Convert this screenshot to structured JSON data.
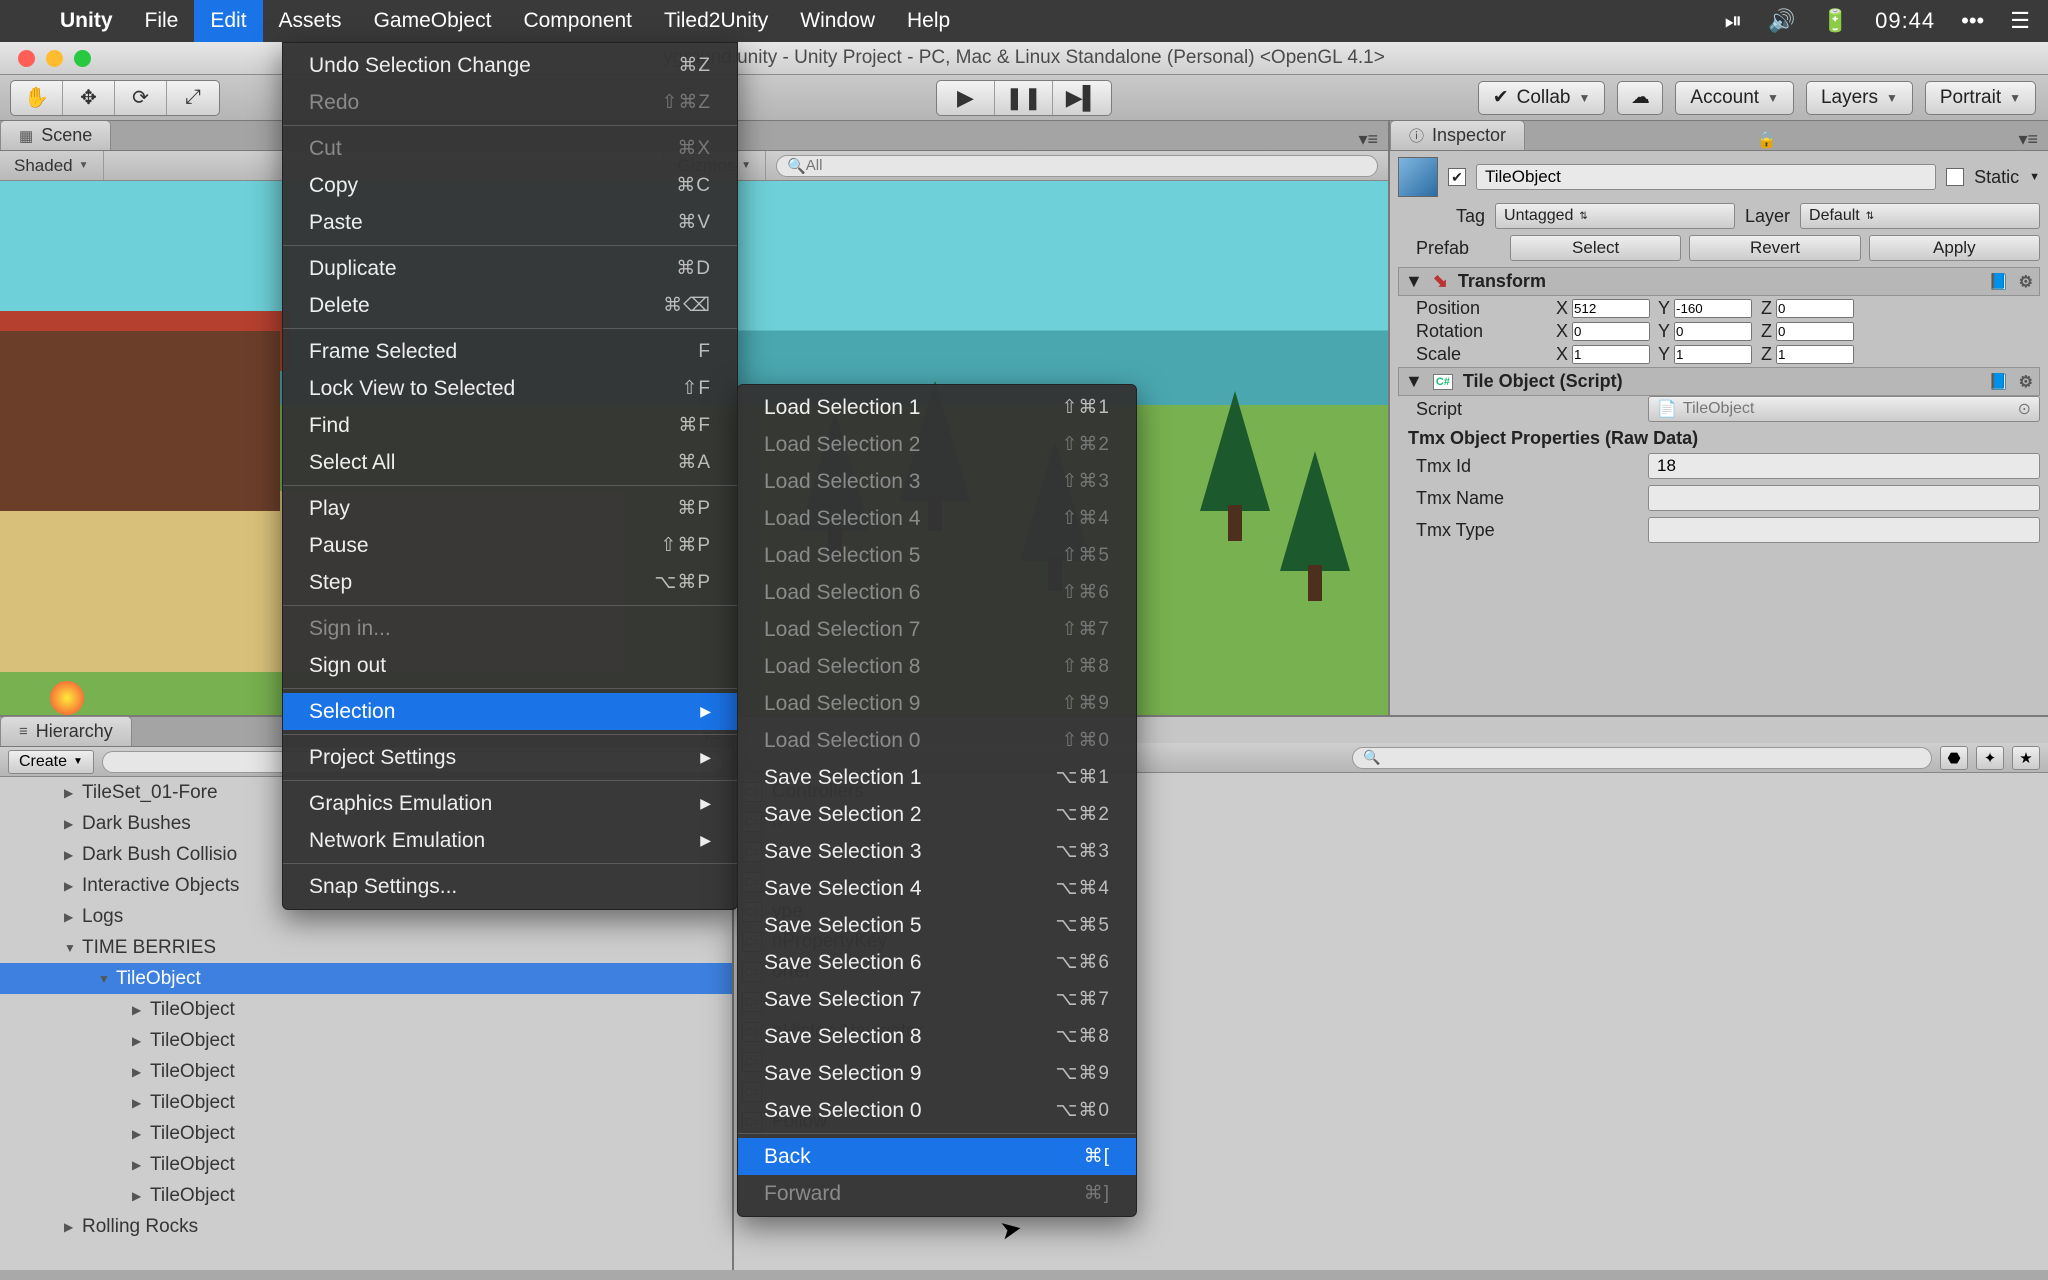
{
  "menubar": {
    "app": "Unity",
    "items": [
      "File",
      "Edit",
      "Assets",
      "GameObject",
      "Component",
      "Tiled2Unity",
      "Window",
      "Help"
    ],
    "active_index": 1,
    "clock": "09:44"
  },
  "window": {
    "title": "yground.unity - Unity Project - PC, Mac & Linux Standalone (Personal) <OpenGL 4.1>"
  },
  "toolbar": {
    "collab": "Collab",
    "account": "Account",
    "layers": "Layers",
    "layout": "Portrait"
  },
  "scene": {
    "tab": "Scene",
    "shading": "Shaded",
    "gizmos": "Gizmos",
    "search_placeholder": "All"
  },
  "hierarchy": {
    "tab": "Hierarchy",
    "create": "Create",
    "items": [
      {
        "label": "TileSet_01-Fore",
        "indent": 1,
        "tri": "▶"
      },
      {
        "label": "Dark Bushes",
        "indent": 1,
        "tri": "▶"
      },
      {
        "label": "Dark Bush Collisio",
        "indent": 1,
        "tri": "▶"
      },
      {
        "label": "Interactive Objects",
        "indent": 1,
        "tri": "▶"
      },
      {
        "label": "Logs",
        "indent": 1,
        "tri": "▶"
      },
      {
        "label": "TIME BERRIES",
        "indent": 1,
        "tri": "▼"
      },
      {
        "label": "TileObject",
        "indent": 2,
        "tri": "▼",
        "selected": true
      },
      {
        "label": "TileObject",
        "indent": 3,
        "tri": "▶"
      },
      {
        "label": "TileObject",
        "indent": 3,
        "tri": "▶"
      },
      {
        "label": "TileObject",
        "indent": 3,
        "tri": "▶"
      },
      {
        "label": "TileObject",
        "indent": 3,
        "tri": "▶"
      },
      {
        "label": "TileObject",
        "indent": 3,
        "tri": "▶"
      },
      {
        "label": "TileObject",
        "indent": 3,
        "tri": "▶"
      },
      {
        "label": "TileObject",
        "indent": 3,
        "tri": "▶"
      },
      {
        "label": "Rolling Rocks",
        "indent": 1,
        "tri": "▶"
      }
    ]
  },
  "project": {
    "items": [
      "Controllers",
      "n",
      "s",
      "",
      "ype",
      "nPropertyKey",
      "orter",
      "e",
      "nHistoryNavigator",
      "",
      "",
      "Follow"
    ]
  },
  "inspector": {
    "tab": "Inspector",
    "name": "TileObject",
    "static": "Static",
    "tag_label": "Tag",
    "tag_value": "Untagged",
    "layer_label": "Layer",
    "layer_value": "Default",
    "prefab_label": "Prefab",
    "prefab_buttons": [
      "Select",
      "Revert",
      "Apply"
    ],
    "transform": {
      "header": "Transform",
      "rows": [
        {
          "label": "Position",
          "x": "512",
          "y": "-160",
          "z": "0"
        },
        {
          "label": "Rotation",
          "x": "0",
          "y": "0",
          "z": "0"
        },
        {
          "label": "Scale",
          "x": "1",
          "y": "1",
          "z": "1"
        }
      ]
    },
    "script": {
      "header": "Tile Object (Script)",
      "script_label": "Script",
      "script_value": "TileObject",
      "raw_header": "Tmx Object Properties (Raw Data)",
      "props": [
        {
          "label": "Tmx Id",
          "value": "18"
        },
        {
          "label": "Tmx Name",
          "value": ""
        },
        {
          "label": "Tmx Type",
          "value": ""
        }
      ]
    }
  },
  "edit_menu": [
    {
      "label": "Undo Selection Change",
      "shortcut": "⌘Z"
    },
    {
      "label": "Redo",
      "shortcut": "⇧⌘Z",
      "disabled": true
    },
    {
      "sep": true
    },
    {
      "label": "Cut",
      "shortcut": "⌘X",
      "disabled": true
    },
    {
      "label": "Copy",
      "shortcut": "⌘C"
    },
    {
      "label": "Paste",
      "shortcut": "⌘V"
    },
    {
      "sep": true
    },
    {
      "label": "Duplicate",
      "shortcut": "⌘D"
    },
    {
      "label": "Delete",
      "shortcut": "⌘⌫"
    },
    {
      "sep": true
    },
    {
      "label": "Frame Selected",
      "shortcut": "F"
    },
    {
      "label": "Lock View to Selected",
      "shortcut": "⇧F"
    },
    {
      "label": "Find",
      "shortcut": "⌘F"
    },
    {
      "label": "Select All",
      "shortcut": "⌘A"
    },
    {
      "sep": true
    },
    {
      "label": "Play",
      "shortcut": "⌘P"
    },
    {
      "label": "Pause",
      "shortcut": "⇧⌘P"
    },
    {
      "label": "Step",
      "shortcut": "⌥⌘P"
    },
    {
      "sep": true
    },
    {
      "label": "Sign in...",
      "disabled": true
    },
    {
      "label": "Sign out"
    },
    {
      "sep": true
    },
    {
      "label": "Selection",
      "submenu": true,
      "highlight": true
    },
    {
      "sep": true
    },
    {
      "label": "Project Settings",
      "submenu": true
    },
    {
      "sep": true
    },
    {
      "label": "Graphics Emulation",
      "submenu": true
    },
    {
      "label": "Network Emulation",
      "submenu": true
    },
    {
      "sep": true
    },
    {
      "label": "Snap Settings..."
    }
  ],
  "selection_menu": [
    {
      "label": "Load Selection 1",
      "shortcut": "⇧⌘1"
    },
    {
      "label": "Load Selection 2",
      "shortcut": "⇧⌘2",
      "disabled": true
    },
    {
      "label": "Load Selection 3",
      "shortcut": "⇧⌘3",
      "disabled": true
    },
    {
      "label": "Load Selection 4",
      "shortcut": "⇧⌘4",
      "disabled": true
    },
    {
      "label": "Load Selection 5",
      "shortcut": "⇧⌘5",
      "disabled": true
    },
    {
      "label": "Load Selection 6",
      "shortcut": "⇧⌘6",
      "disabled": true
    },
    {
      "label": "Load Selection 7",
      "shortcut": "⇧⌘7",
      "disabled": true
    },
    {
      "label": "Load Selection 8",
      "shortcut": "⇧⌘8",
      "disabled": true
    },
    {
      "label": "Load Selection 9",
      "shortcut": "⇧⌘9",
      "disabled": true
    },
    {
      "label": "Load Selection 0",
      "shortcut": "⇧⌘0",
      "disabled": true
    },
    {
      "label": "Save Selection 1",
      "shortcut": "⌥⌘1"
    },
    {
      "label": "Save Selection 2",
      "shortcut": "⌥⌘2"
    },
    {
      "label": "Save Selection 3",
      "shortcut": "⌥⌘3"
    },
    {
      "label": "Save Selection 4",
      "shortcut": "⌥⌘4"
    },
    {
      "label": "Save Selection 5",
      "shortcut": "⌥⌘5"
    },
    {
      "label": "Save Selection 6",
      "shortcut": "⌥⌘6"
    },
    {
      "label": "Save Selection 7",
      "shortcut": "⌥⌘7"
    },
    {
      "label": "Save Selection 8",
      "shortcut": "⌥⌘8"
    },
    {
      "label": "Save Selection 9",
      "shortcut": "⌥⌘9"
    },
    {
      "label": "Save Selection 0",
      "shortcut": "⌥⌘0"
    },
    {
      "sep": true
    },
    {
      "label": "Back",
      "shortcut": "⌘[",
      "highlight": true
    },
    {
      "label": "Forward",
      "shortcut": "⌘]",
      "disabled": true
    }
  ]
}
